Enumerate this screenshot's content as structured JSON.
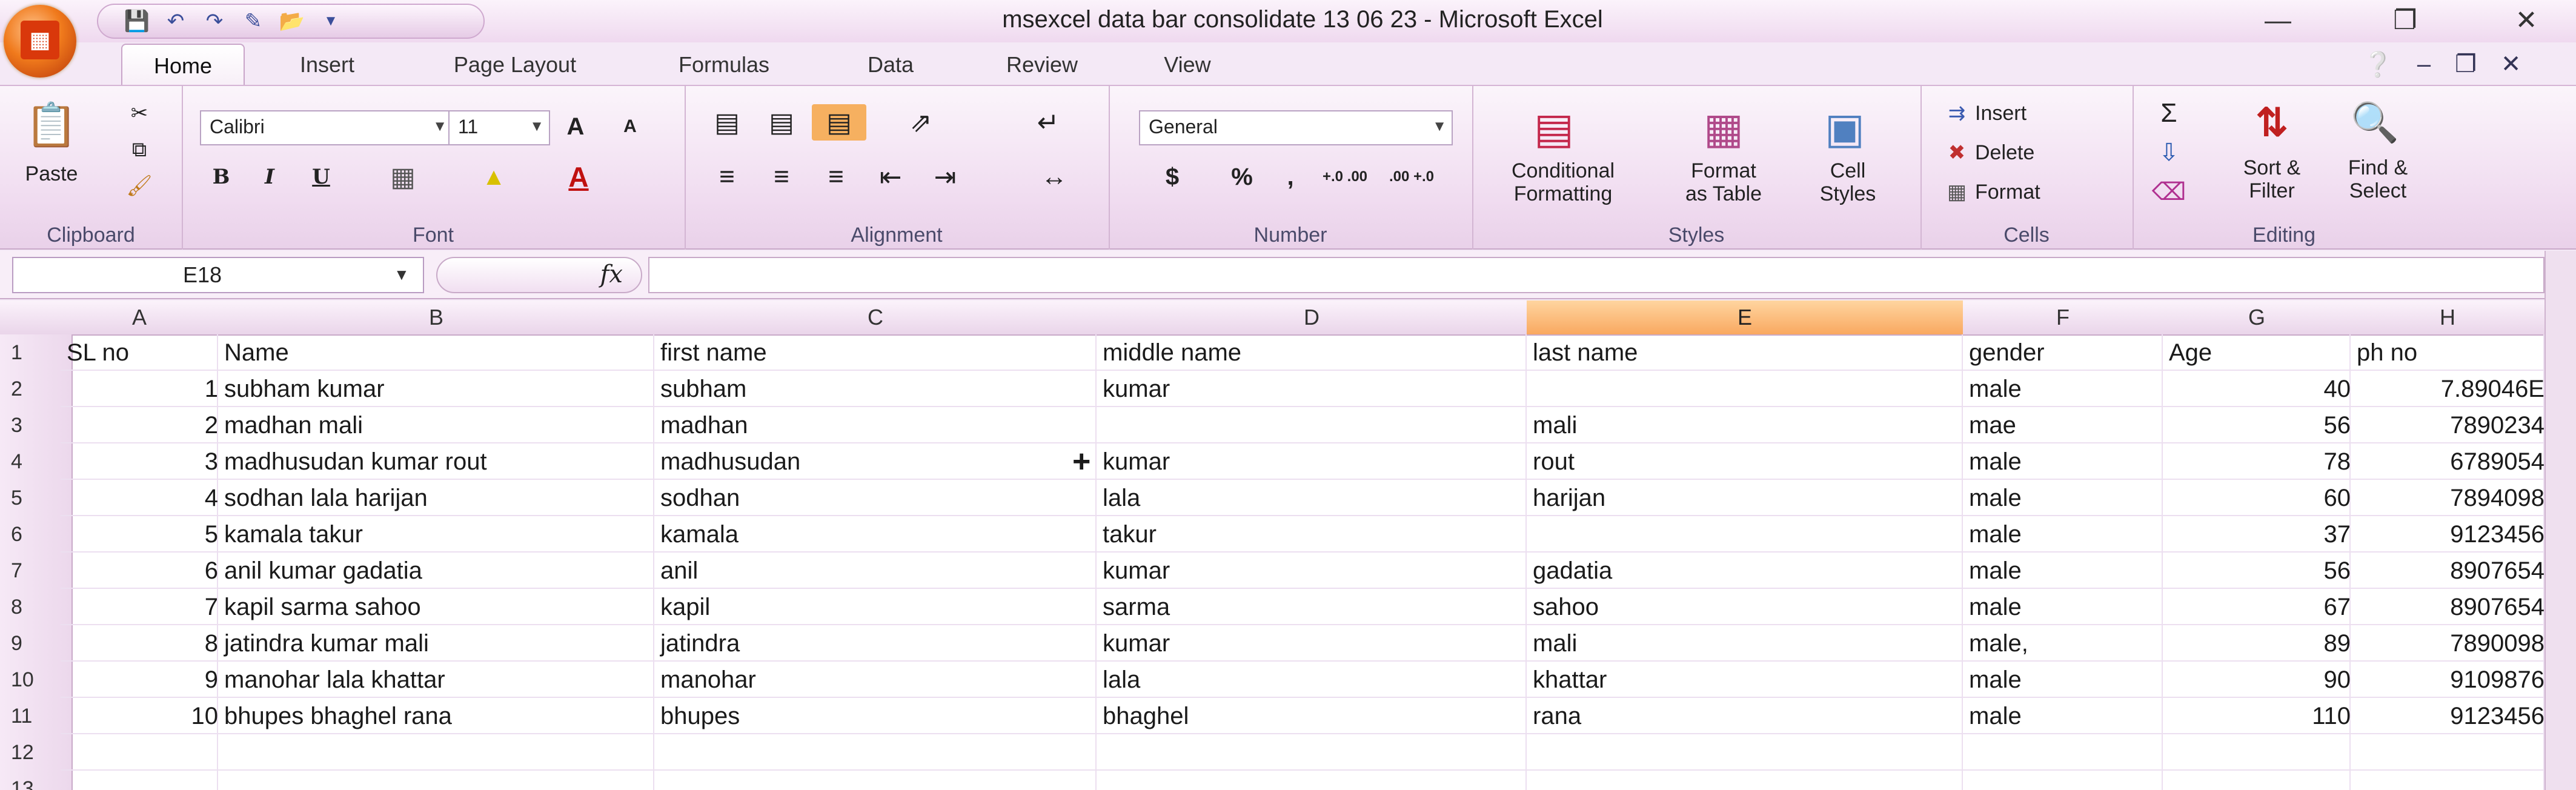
{
  "window": {
    "title": "msexcel data bar consolidate 13 06 23 - Microsoft Excel"
  },
  "tabs": [
    "Home",
    "Insert",
    "Page Layout",
    "Formulas",
    "Data",
    "Review",
    "View"
  ],
  "ribbon": {
    "clipboard": {
      "paste": "Paste",
      "label": "Clipboard"
    },
    "font": {
      "name": "Calibri",
      "size": "11",
      "grow": "A",
      "shrink": "A",
      "bold": "B",
      "italic": "I",
      "underline": "U",
      "font_color": "A",
      "label": "Font"
    },
    "alignment": {
      "label": "Alignment"
    },
    "number": {
      "format": "General",
      "currency": "$",
      "percent": "%",
      "comma": ",",
      "inc_decimal": "+.0 .00",
      "dec_decimal": ".00 +.0",
      "label": "Number"
    },
    "styles": {
      "conditional": [
        "Conditional",
        "Formatting"
      ],
      "format_table": [
        "Format",
        "as Table"
      ],
      "cell_styles": [
        "Cell",
        "Styles"
      ],
      "label": "Styles"
    },
    "cells": {
      "insert": "Insert",
      "delete": "Delete",
      "format": "Format",
      "label": "Cells"
    },
    "editing": {
      "sigma": "Σ",
      "sort_filter": [
        "Sort &",
        "Filter"
      ],
      "find_select": [
        "Find &",
        "Select"
      ],
      "label": "Editing"
    }
  },
  "formula_bar": {
    "name_box": "E18",
    "fx": "fx",
    "content": ""
  },
  "columns": [
    "A",
    "B",
    "C",
    "D",
    "E",
    "F",
    "G",
    "H"
  ],
  "selected_column": "E",
  "row_numbers": [
    "1",
    "2",
    "3",
    "4",
    "5",
    "6",
    "7",
    "8",
    "9",
    "10",
    "11",
    "12",
    "13"
  ],
  "headers": [
    "SL no",
    "Name",
    "first name",
    "middle name",
    "last name",
    "gender",
    "Age",
    "ph no"
  ],
  "rows": [
    [
      "1",
      "subham kumar",
      "subham",
      "kumar",
      "",
      "male",
      "40",
      "7.89046E"
    ],
    [
      "2",
      "madhan mali",
      "madhan",
      "",
      "mali",
      "mae",
      "56",
      "7890234"
    ],
    [
      "3",
      "madhusudan kumar  rout",
      "madhusudan",
      "kumar",
      "rout",
      "male",
      "78",
      "6789054"
    ],
    [
      "4",
      "sodhan lala harijan",
      "sodhan",
      "lala",
      "harijan",
      "male",
      "60",
      "7894098"
    ],
    [
      "5",
      "kamala takur",
      "kamala",
      "takur",
      "",
      "male",
      "37",
      "9123456"
    ],
    [
      "6",
      "anil kumar gadatia",
      "anil",
      "kumar",
      "gadatia",
      "male",
      "56",
      "8907654"
    ],
    [
      "7",
      "kapil sarma sahoo",
      "kapil",
      "sarma",
      "sahoo",
      "male",
      "67",
      "8907654"
    ],
    [
      "8",
      "jatindra kumar mali",
      "jatindra",
      "kumar",
      "mali",
      "male,",
      "89",
      "7890098"
    ],
    [
      "9",
      "manohar lala khattar",
      "manohar",
      "lala",
      "khattar",
      "male",
      "90",
      "9109876"
    ],
    [
      "10",
      "bhupes bhaghel rana",
      "bhupes",
      "bhaghel",
      "rana",
      "male",
      "110",
      "9123456"
    ]
  ]
}
